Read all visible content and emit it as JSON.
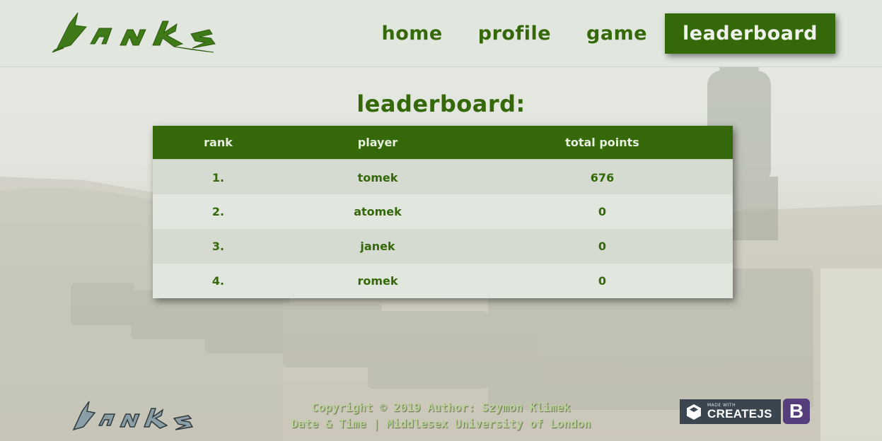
{
  "header": {
    "logo_text": "tanks",
    "nav": [
      {
        "label": "home",
        "active": false
      },
      {
        "label": "profile",
        "active": false
      },
      {
        "label": "game",
        "active": false
      },
      {
        "label": "leaderboard",
        "active": true
      }
    ]
  },
  "main": {
    "title": "leaderboard:",
    "table": {
      "columns": [
        "rank",
        "player",
        "total points"
      ],
      "rows": [
        {
          "rank": "1.",
          "player": "tomek",
          "points": "676"
        },
        {
          "rank": "2.",
          "player": "atomek",
          "points": "0"
        },
        {
          "rank": "3.",
          "player": "janek",
          "points": "0"
        },
        {
          "rank": "4.",
          "player": "romek",
          "points": "0"
        }
      ]
    }
  },
  "footer": {
    "logo_text": "tanks",
    "copyright": "Copyright © 2019 Author: Szymon Klimek",
    "subline": "Date & Time | Middlesex University of London",
    "createjs_made": "MADE WITH",
    "createjs_name": "CREATEJS",
    "bootstrap_letter": "B"
  },
  "colors": {
    "brand_green": "#346808",
    "header_bg": "#e1e6de",
    "row_dark": "#d5dbd1",
    "row_light": "#e1e6de"
  },
  "icons": [
    "tanks-logo",
    "createjs-cube-icon",
    "bootstrap-icon"
  ]
}
